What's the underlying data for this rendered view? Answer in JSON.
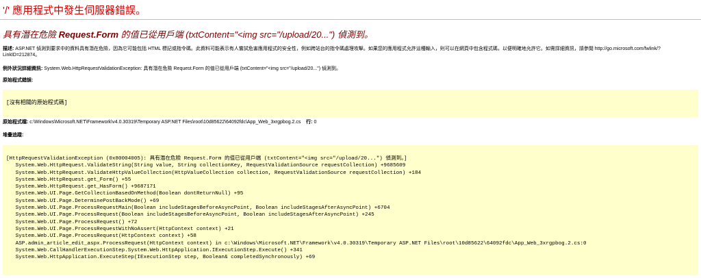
{
  "header": {
    "title": "'/' 應用程式中發生伺服器錯誤。"
  },
  "error": {
    "heading_prefix": "具有潛在危險 ",
    "heading_bold": "Request.Form",
    "heading_suffix": " 的值已從用戶端 (txtContent=\"<img src=\"/upload/20...\") 偵測到。"
  },
  "description": {
    "label": "描述:",
    "text": " ASP.NET 偵測到要求中的資料具有潛在危險，因為它可能包括 HTML 標記或指令碼。此資料可能表示有人嘗試危害應用程式的安全性，例如跨站台的指令碼處理攻擊。如果您的應用程式允許這種輸入，則可以在網頁中包含程式碼，以便明確地允許它。如需詳細資訊，請參閱 http://go.microsoft.com/fwlink/?LinkID=212874。"
  },
  "exception": {
    "label": "例外狀況詳細資訊:",
    "text": " System.Web.HttpRequestValidationException: 具有潛在危險 Request.Form 的值已從用戶端 (txtContent=\"<img src=\"/upload/20...\") 偵測到。"
  },
  "source_error": {
    "label": "原始程式錯誤:",
    "box_text": "[沒有相關的原始程式碼]"
  },
  "source_file": {
    "label": "原始程式檔:",
    "path": " c:\\Windows\\Microsoft.NET\\Framework\\v4.0.30319\\Temporary ASP.NET Files\\root\\10d85622\\64092fdc\\App_Web_3xrgpbog.2.cs",
    "line_label": "行:",
    "line_value": " 0"
  },
  "stack_trace": {
    "label": "堆疊追蹤:",
    "lines": [
      "[HttpRequestValidationException (0x80004005): 具有潛在危險 Request.Form 的值已從用戶端 (txtContent=\"<img src=\"/upload/20...\") 偵測到。]",
      "   System.Web.HttpRequest.ValidateString(String value, String collectionKey, RequestValidationSource requestCollection) +9685609",
      "   System.Web.HttpRequest.ValidateHttpValueCollection(HttpValueCollection collection, RequestValidationSource requestCollection) +184",
      "   System.Web.HttpRequest.get_Form() +55",
      "   System.Web.HttpRequest.get_HasForm() +9687171",
      "   System.Web.UI.Page.GetCollectionBasedOnMethod(Boolean dontReturnNull) +95",
      "   System.Web.UI.Page.DeterminePostBackMode() +69",
      "   System.Web.UI.Page.ProcessRequestMain(Boolean includeStagesBeforeAsyncPoint, Boolean includeStagesAfterAsyncPoint) +6704",
      "   System.Web.UI.Page.ProcessRequest(Boolean includeStagesBeforeAsyncPoint, Boolean includeStagesAfterAsyncPoint) +245",
      "   System.Web.UI.Page.ProcessRequest() +72",
      "   System.Web.UI.Page.ProcessRequestWithNoAssert(HttpContext context) +21",
      "   System.Web.UI.Page.ProcessRequest(HttpContext context) +58",
      "   ASP.admin_article_edit_aspx.ProcessRequest(HttpContext context) in c:\\Windows\\Microsoft.NET\\Framework\\v4.0.30319\\Temporary ASP.NET Files\\root\\10d85622\\64092fdc\\App_Web_3xrgpbog.2.cs:0",
      "   System.Web.CallHandlerExecutionStep.System.Web.HttpApplication.IExecutionStep.Execute() +341",
      "   System.Web.HttpApplication.ExecuteStep(IExecutionStep step, Boolean& completedSynchronously) +69"
    ]
  },
  "colors": {
    "title_red": "#d40000",
    "heading_maroon": "#800000",
    "box_yellow": "#ffffcc",
    "rule_gray": "#c0c0c0"
  }
}
